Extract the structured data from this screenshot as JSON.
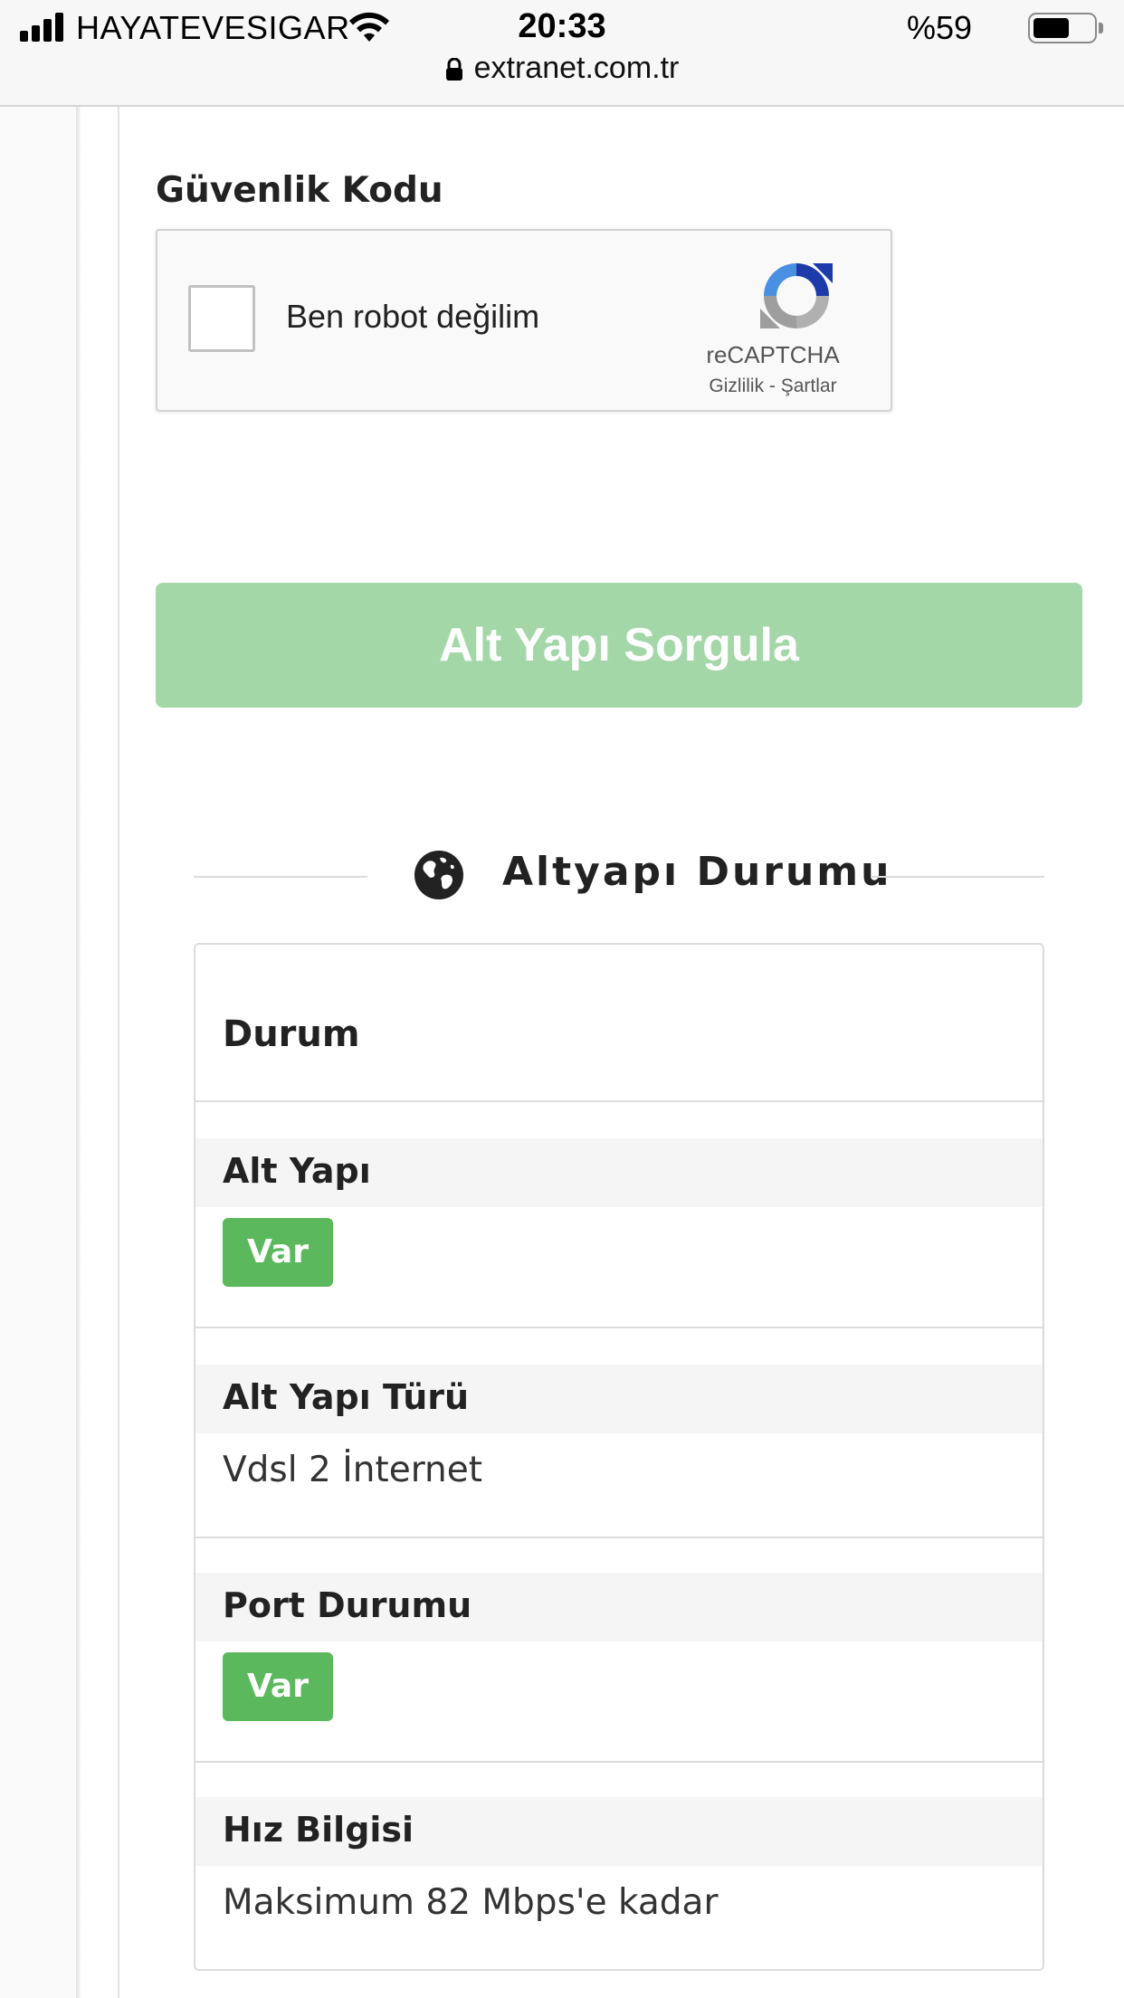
{
  "status_bar": {
    "carrier": "HAYATEVESIGAR",
    "time": "20:33",
    "battery_text": "%59",
    "battery_level": 0.59,
    "url": "extranet.com.tr"
  },
  "captcha": {
    "label": "Güvenlik Kodu",
    "checkbox_text": "Ben robot değilim",
    "brand": "reCAPTCHA",
    "links": "Gizlilik - Şartlar"
  },
  "submit_label": "Alt Yapı Sorgula",
  "section": {
    "title": "Altyapı Durumu",
    "icon": "globe-icon"
  },
  "status_card": {
    "header": "Durum",
    "rows": [
      {
        "label": "Alt Yapı",
        "badge": "Var"
      },
      {
        "label": "Alt Yapı Türü",
        "value": "Vdsl 2 İnternet"
      },
      {
        "label": "Port Durumu",
        "badge": "Var"
      },
      {
        "label": "Hız Bilgisi",
        "value": "Maksimum 82 Mbps'e kadar"
      }
    ]
  },
  "colors": {
    "submit_bg": "#a3d7a8",
    "badge_bg": "#5cb85c",
    "label_bar_bg": "#f5f5f5"
  }
}
